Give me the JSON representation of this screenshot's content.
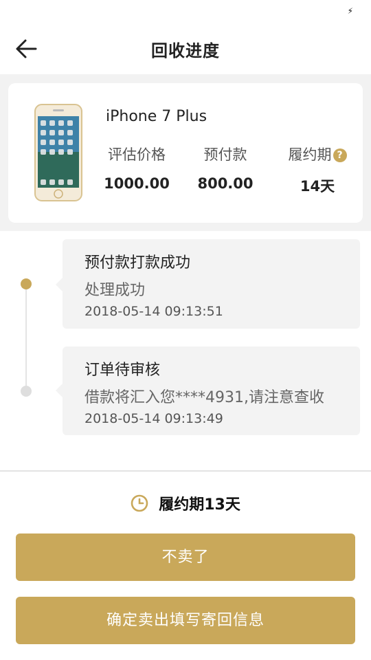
{
  "status_bar": {
    "charging_icon": "bolt-icon"
  },
  "header": {
    "title": "回收进度",
    "back_icon": "arrow-left-icon"
  },
  "product": {
    "name": "iPhone 7 Plus",
    "image_icon": "phone-image",
    "price_label": "评估价格",
    "price_value": "1000.00",
    "prepay_label": "预付款",
    "prepay_value": "800.00",
    "term_label": "履约期",
    "term_value": "14天",
    "help_icon": "question-circle-icon",
    "help_glyph": "?"
  },
  "timeline": [
    {
      "title": "预付款打款成功",
      "desc": "处理成功",
      "time": "2018-05-14 09:13:51",
      "active": true
    },
    {
      "title": "订单待审核",
      "desc": "借款将汇入您****4931,请注意查收",
      "time": "2018-05-14 09:13:49",
      "active": false
    }
  ],
  "deadline": {
    "text": "履约期13天",
    "icon": "clock-icon"
  },
  "buttons": {
    "decline": "不卖了",
    "confirm": "确定卖出填写寄回信息"
  },
  "colors": {
    "accent": "#c9a85a",
    "background": "#f2f2f2",
    "card": "#ffffff",
    "timeline_card": "#f3f3f3"
  }
}
